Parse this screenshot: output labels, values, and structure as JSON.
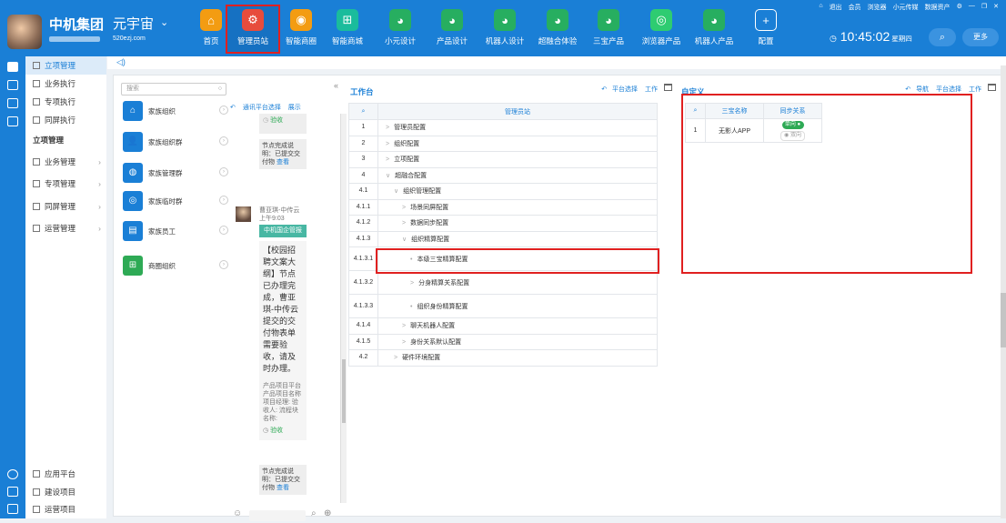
{
  "header": {
    "company": "中机集团",
    "brand": "元宇宙",
    "brand_url": "520ezj.com",
    "nav": [
      {
        "label": "首页",
        "icon": "home-icon",
        "color": "#f39c12",
        "glyph": "⌂"
      },
      {
        "label": "管理员站",
        "icon": "admin-icon",
        "color": "#e74c3c",
        "glyph": "⚙"
      },
      {
        "label": "智能商圈",
        "icon": "business-circle-icon",
        "color": "#f39c12",
        "glyph": "◉"
      },
      {
        "label": "智能商城",
        "icon": "cart-icon",
        "color": "#1abc9c",
        "glyph": "⊞"
      },
      {
        "label": "小元设计",
        "icon": "globe-icon",
        "color": "#27ae60",
        "glyph": "◕"
      },
      {
        "label": "产品设计",
        "icon": "robot-icon",
        "color": "#27ae60",
        "glyph": "◕"
      },
      {
        "label": "机器人设计",
        "icon": "robot-icon",
        "color": "#27ae60",
        "glyph": "◕"
      },
      {
        "label": "超融合体验",
        "icon": "robot-icon",
        "color": "#27ae60",
        "glyph": "◕"
      },
      {
        "label": "三宝产品",
        "icon": "robot-icon",
        "color": "#27ae60",
        "glyph": "◕"
      },
      {
        "label": "浏览器产品",
        "icon": "browser-icon",
        "color": "#2ecc71",
        "glyph": "◎"
      },
      {
        "label": "机器人产品",
        "icon": "robot-icon",
        "color": "#27ae60",
        "glyph": "◕"
      },
      {
        "label": "配置",
        "icon": "plus-icon",
        "color": "#1a7fd6",
        "glyph": "+"
      }
    ],
    "window_links": [
      "退出",
      "会员",
      "浏览器",
      "小元传媒",
      "数据资产"
    ],
    "time": "10:45:02",
    "weekday": "星期四",
    "more": "更多"
  },
  "sidebar": {
    "top": [
      {
        "label": "立项管理",
        "active": true
      },
      {
        "label": "业务执行"
      },
      {
        "label": "专项执行"
      },
      {
        "label": "同屏执行"
      }
    ],
    "section_title": "立项管理",
    "groups": [
      {
        "label": "业务管理"
      },
      {
        "label": "专项管理"
      },
      {
        "label": "同屏管理"
      },
      {
        "label": "运营管理"
      }
    ],
    "bottom": [
      {
        "label": "应用平台"
      },
      {
        "label": "建设项目"
      },
      {
        "label": "运营项目"
      }
    ]
  },
  "org": {
    "search_placeholder": "搜索",
    "items": [
      {
        "label": "家族组织",
        "icon": "org-icon"
      },
      {
        "label": "家族组织群",
        "icon": "group-icon"
      },
      {
        "label": "家族管理群",
        "icon": "manage-group-icon"
      },
      {
        "label": "家族临时群",
        "icon": "temp-group-icon"
      },
      {
        "label": "家族员工",
        "icon": "employee-icon"
      },
      {
        "label": "商圈组织",
        "icon": "business-org-icon"
      }
    ]
  },
  "chat": {
    "toolbar": {
      "platform": "通讯平台选择",
      "show": "展示"
    },
    "accept": "验收",
    "bubble1": {
      "text": "节点完成说明：已提交交付物",
      "link": "查看"
    },
    "sender": "曹亚琪-中传云",
    "sent_time": "上午9:03",
    "green_label": "中机国企管报",
    "message": "【校园招聘文案大纲】节点已办理完成，曹亚琪-中传云提交的交付物表单需要验收，请及时办理。",
    "detail": "产品项目平台 产品项目名称 项目经理: 验收人: 流程块名称:",
    "accept2": "验收",
    "bubble2": {
      "text": "节点完成说明：已提交交付物",
      "link": "查看"
    }
  },
  "workbench": {
    "title": "工作台",
    "links": [
      "平台选择",
      "工作"
    ],
    "column_header": "管理员站",
    "rows": [
      {
        "num": "1",
        "label": "管理员配置",
        "twist": ">",
        "indent": 0
      },
      {
        "num": "2",
        "label": "组织配置",
        "twist": ">",
        "indent": 0
      },
      {
        "num": "3",
        "label": "立项配置",
        "twist": ">",
        "indent": 0
      },
      {
        "num": "4",
        "label": "超融合配置",
        "twist": "∨",
        "indent": 0
      },
      {
        "num": "4.1",
        "label": "组织管理配置",
        "twist": "∨",
        "indent": 1
      },
      {
        "num": "4.1.1",
        "label": "场景同屏配置",
        "twist": ">",
        "indent": 2
      },
      {
        "num": "4.1.2",
        "label": "数据同步配置",
        "twist": ">",
        "indent": 2
      },
      {
        "num": "4.1.3",
        "label": "组织精算配置",
        "twist": "∨",
        "indent": 2
      },
      {
        "num": "4.1.3.1",
        "label": "本级三宝精算配置",
        "twist": "•",
        "indent": 3,
        "tall": true
      },
      {
        "num": "4.1.3.2",
        "label": "分身精算关系配置",
        "twist": ">",
        "indent": 3,
        "tall": true
      },
      {
        "num": "4.1.3.3",
        "label": "组织身份精算配置",
        "twist": "•",
        "indent": 3,
        "tall": true
      },
      {
        "num": "4.1.4",
        "label": "聊天机器人配置",
        "twist": ">",
        "indent": 2
      },
      {
        "num": "4.1.5",
        "label": "身份关系默认配置",
        "twist": ">",
        "indent": 2
      },
      {
        "num": "4.2",
        "label": "硬件环境配置",
        "twist": ">",
        "indent": 1
      }
    ]
  },
  "custom": {
    "title": "自定义",
    "links": [
      "导航",
      "平台选择",
      "工作"
    ],
    "headers": [
      "三宝名称",
      "同步关系"
    ],
    "rows": [
      {
        "num": "1",
        "name": "无影人APP",
        "sync_on": "单向",
        "sync_off": "双向"
      }
    ]
  }
}
